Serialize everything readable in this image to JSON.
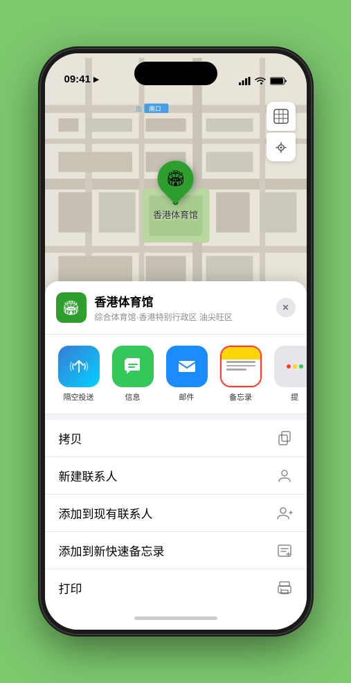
{
  "status_bar": {
    "time": "09:41",
    "location_icon": "▶"
  },
  "map": {
    "label": "南口",
    "pin_emoji": "🏟",
    "pin_label": "香港体育馆"
  },
  "location_card": {
    "name": "香港体育馆",
    "subtitle": "综合体育馆·香港特别行政区 油尖旺区",
    "close_label": "✕"
  },
  "share_items": [
    {
      "id": "airdrop",
      "label": "隔空投送",
      "icon_type": "airdrop"
    },
    {
      "id": "message",
      "label": "信息",
      "icon_type": "message"
    },
    {
      "id": "mail",
      "label": "邮件",
      "icon_type": "mail"
    },
    {
      "id": "notes",
      "label": "备忘录",
      "icon_type": "notes"
    },
    {
      "id": "more",
      "label": "提",
      "icon_type": "more"
    }
  ],
  "action_items": [
    {
      "id": "copy",
      "label": "拷贝",
      "icon": "📋"
    },
    {
      "id": "new-contact",
      "label": "新建联系人",
      "icon": "👤"
    },
    {
      "id": "add-existing",
      "label": "添加到现有联系人",
      "icon": "👤"
    },
    {
      "id": "add-quick-note",
      "label": "添加到新快速备忘录",
      "icon": "📝"
    },
    {
      "id": "print",
      "label": "打印",
      "icon": "🖨"
    }
  ],
  "map_controls": {
    "map_icon": "🗺",
    "location_icon": "➤"
  },
  "colors": {
    "green": "#2e9e2e",
    "accent_blue": "#007aff",
    "highlight_red": "#ff3b30"
  }
}
